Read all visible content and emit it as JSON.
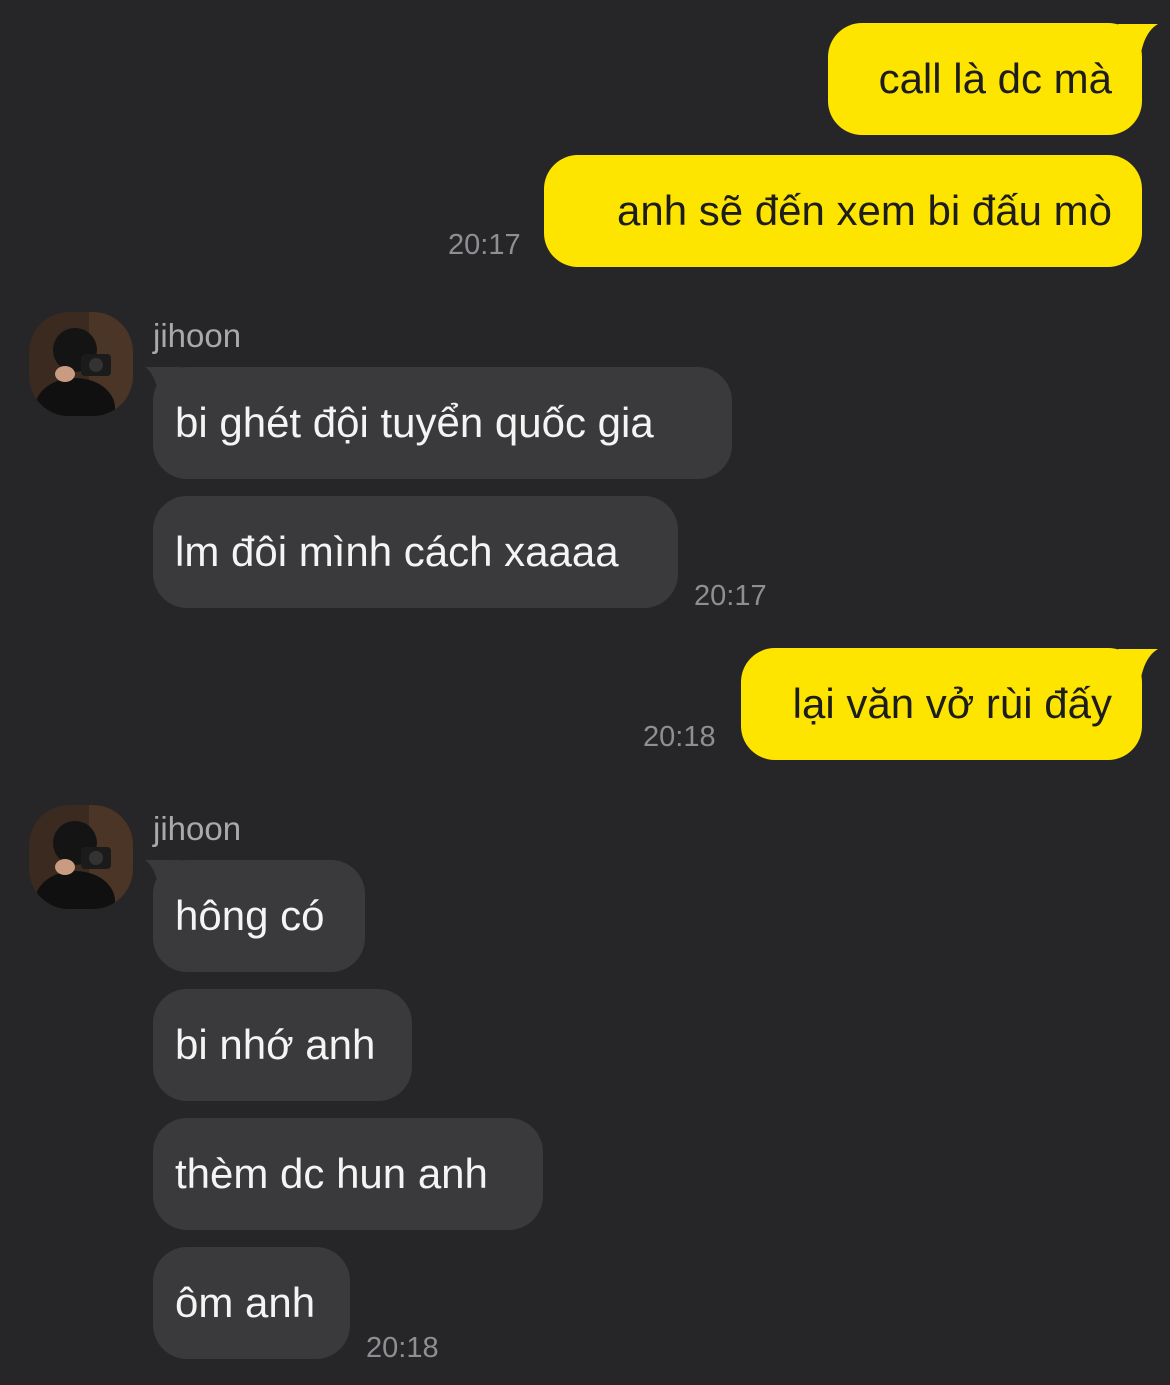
{
  "chat": {
    "contact_name": "jihoon",
    "messages": [
      {
        "side": "out",
        "text": "call là dc mà"
      },
      {
        "side": "out",
        "text": "anh sẽ đến xem bi đấu mò",
        "time": "20:17"
      },
      {
        "side": "in",
        "text": "bi ghét đội tuyển quốc gia"
      },
      {
        "side": "in",
        "text": "lm đôi mình cách xaaaa",
        "time": "20:17"
      },
      {
        "side": "out",
        "text": "lại văn vở rùi đấy",
        "time": "20:18"
      },
      {
        "side": "in",
        "text": "hông có"
      },
      {
        "side": "in",
        "text": "bi nhớ anh"
      },
      {
        "side": "in",
        "text": "thèm dc hun anh"
      },
      {
        "side": "in",
        "text": "ôm anh",
        "time": "20:18"
      }
    ]
  },
  "colors": {
    "background": "#262628",
    "outgoing_bubble": "#FEE500",
    "incoming_bubble": "#3a3a3c",
    "timestamp": "#8e8e93"
  },
  "icons": {
    "avatar": "profile-photo-person-with-camera"
  }
}
